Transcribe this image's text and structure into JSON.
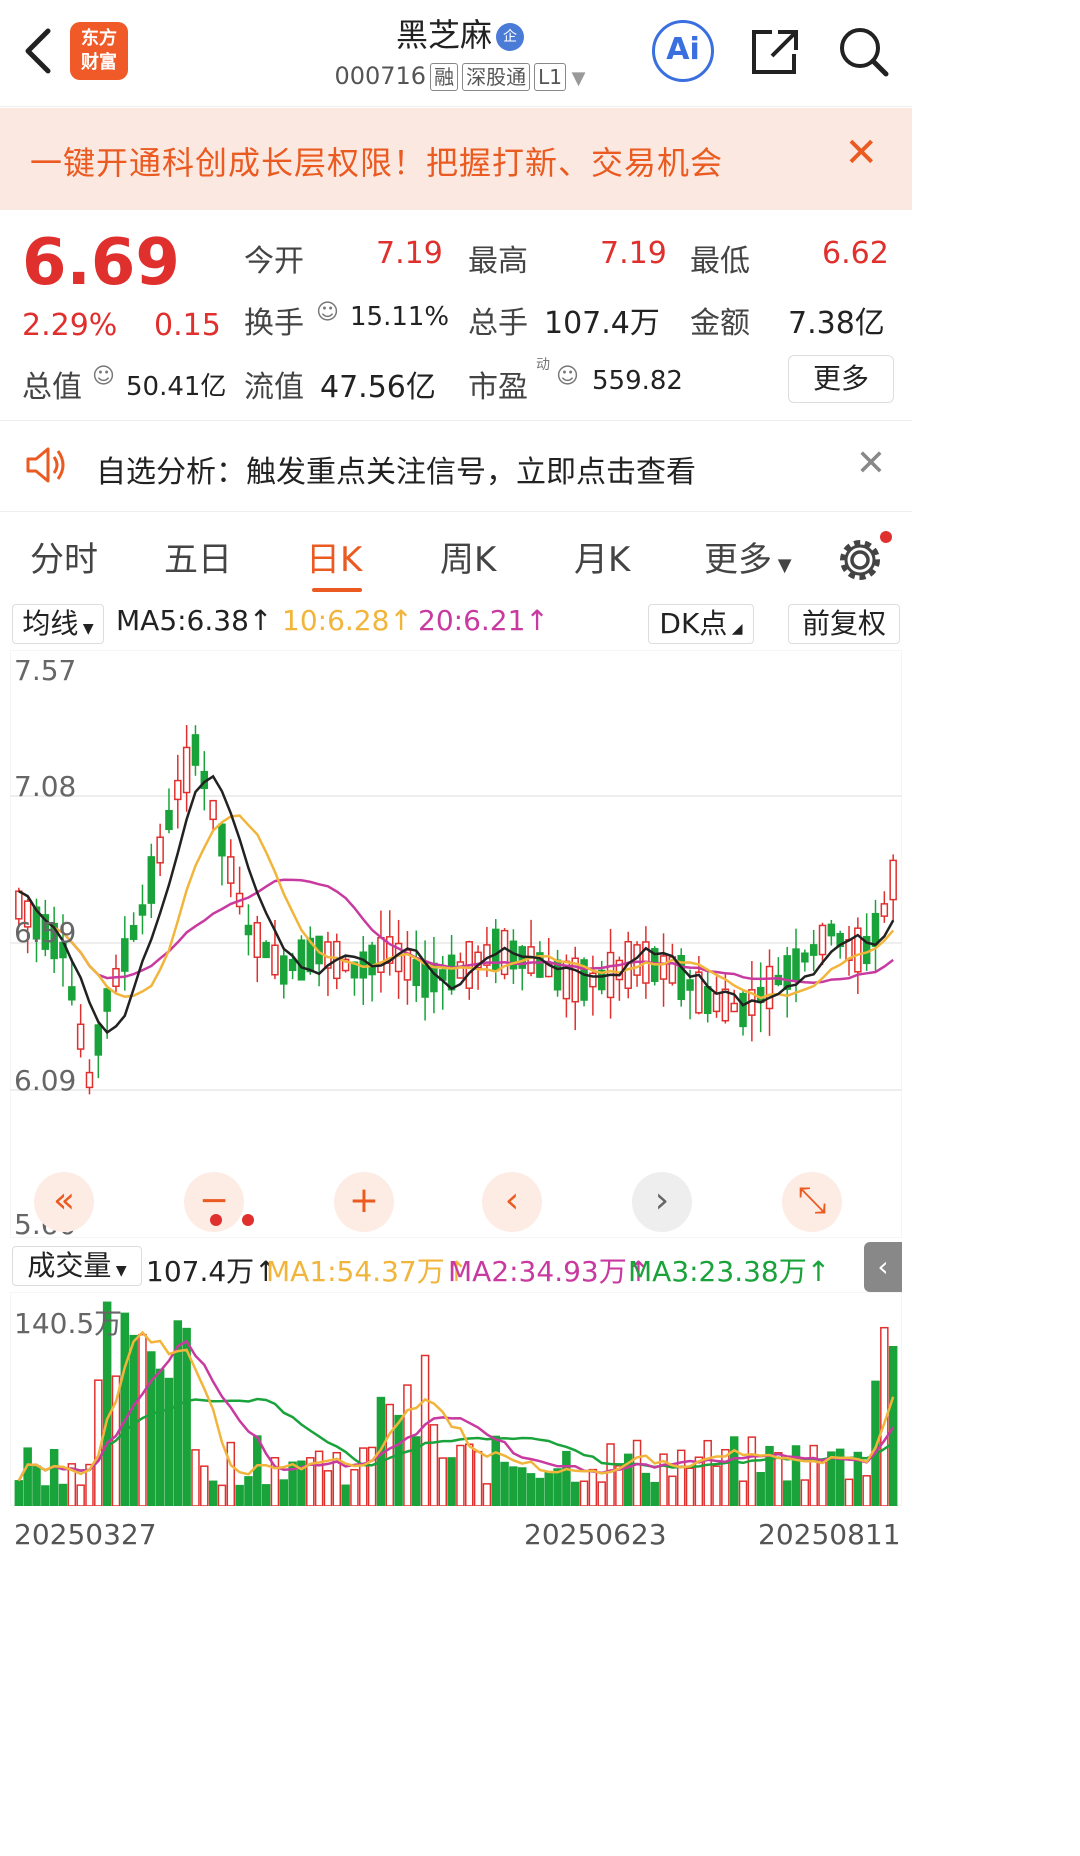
{
  "header": {
    "logo_line1": "东方",
    "logo_line2": "财富",
    "title": "黑芝麻",
    "title_badge": "企",
    "code": "000716",
    "tag1": "融",
    "tag2": "深股通",
    "tag3": "L1",
    "ai_label": "Ai"
  },
  "banner": {
    "text": "一键开通科创成长层权限！把握打新、交易机会"
  },
  "quote": {
    "price": "6.69",
    "change_pct": "2.29%",
    "change": "0.15",
    "open_label": "今开",
    "open": "7.19",
    "high_label": "最高",
    "high": "7.19",
    "low_label": "最低",
    "low": "6.62",
    "turnover_label": "换手",
    "turnover": "15.11%",
    "volume_label": "总手",
    "volume": "107.4万",
    "amount_label": "金额",
    "amount": "7.38亿",
    "mktcap_label": "总值",
    "mktcap": "50.41亿",
    "float_label": "流值",
    "float": "47.56亿",
    "pe_label": "市盈",
    "pe_super": "动",
    "pe": "559.82",
    "more": "更多"
  },
  "analysis": {
    "text": "自选分析：触发重点关注信号，立即点击查看"
  },
  "tabs": [
    "分时",
    "五日",
    "日K",
    "周K",
    "月K",
    "更多"
  ],
  "kline": {
    "indicator_select": "均线",
    "ma5": "MA5:6.38↑",
    "ma10": "10:6.28↑",
    "ma20": "20:6.21↑",
    "dk_button": "DK点",
    "adjust_button": "前复权",
    "yaxis": [
      "7.57",
      "7.08",
      "6.59",
      "6.09",
      "5.60"
    ]
  },
  "volume": {
    "indicator_select": "成交量",
    "vol": "107.4万↑",
    "ma1": "MA1:54.37万↑",
    "ma2": "MA2:34.93万↑",
    "ma3": "MA3:23.38万↑",
    "ymax": "140.5万"
  },
  "dates": [
    "20250327",
    "20250623",
    "20250811"
  ],
  "controls": [
    "«",
    "−",
    "+",
    "‹",
    "›",
    "⤡"
  ],
  "colors": {
    "up": "#e0302e",
    "down": "#19a33a",
    "accent": "#ea5a21",
    "ma5": "#222222",
    "ma10": "#f2b53c",
    "ma20": "#c83aa0"
  }
}
